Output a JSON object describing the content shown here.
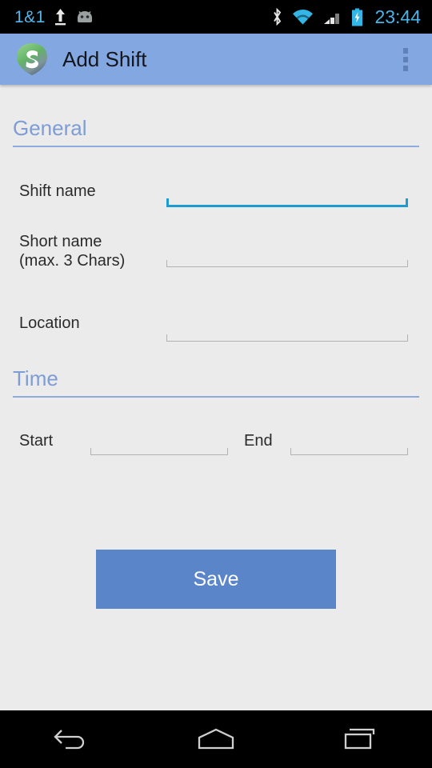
{
  "status_bar": {
    "carrier": "1&1",
    "clock": "23:44",
    "icons": {
      "upload": "upload-arrow-icon",
      "android": "android-mascot-icon",
      "bluetooth": "bluetooth-icon",
      "wifi": "wifi-icon",
      "signal": "cellular-signal-icon",
      "battery": "battery-charging-icon"
    },
    "colors": {
      "background": "#000000",
      "carrier_text": "#55b6e8",
      "clock_text": "#4ab4e6",
      "accent": "#33b5e5"
    }
  },
  "action_bar": {
    "title": "Add Shift",
    "logo_icon": "app-shield-s-logo-icon",
    "overflow_icon": "overflow-menu-icon",
    "background": "#83a7e0",
    "title_color": "#14161c"
  },
  "form": {
    "sections": [
      {
        "id": "general",
        "title": "General"
      },
      {
        "id": "time",
        "title": "Time"
      }
    ],
    "fields": [
      {
        "id": "shift-name",
        "label": "Shift name",
        "value": "",
        "placeholder": "",
        "focused": true
      },
      {
        "id": "short-name",
        "label": "Short name\n(max. 3 Chars)",
        "label_line1": "Short name",
        "label_line2": "(max. 3 Chars)",
        "value": "",
        "placeholder": "",
        "focused": false
      },
      {
        "id": "location",
        "label": "Location",
        "value": "",
        "placeholder": "",
        "focused": false
      },
      {
        "id": "start-time",
        "label": "Start",
        "value": "",
        "placeholder": "",
        "focused": false
      },
      {
        "id": "end-time",
        "label": "End",
        "value": "",
        "placeholder": "",
        "focused": false
      }
    ],
    "save_label": "Save",
    "colors": {
      "background": "#ebebeb",
      "section_title": "#7e9dd6",
      "section_rule": "#8eabdd",
      "label": "#2b2b2b",
      "underline": "#b2b2b2",
      "underline_focused": "#1d9bd1",
      "save_background": "#5a85c9",
      "save_text": "#ffffff"
    }
  },
  "nav_bar": {
    "back_icon": "back-arrow-icon",
    "home_icon": "home-icon",
    "recents_icon": "recent-apps-icon",
    "background": "#000000"
  }
}
